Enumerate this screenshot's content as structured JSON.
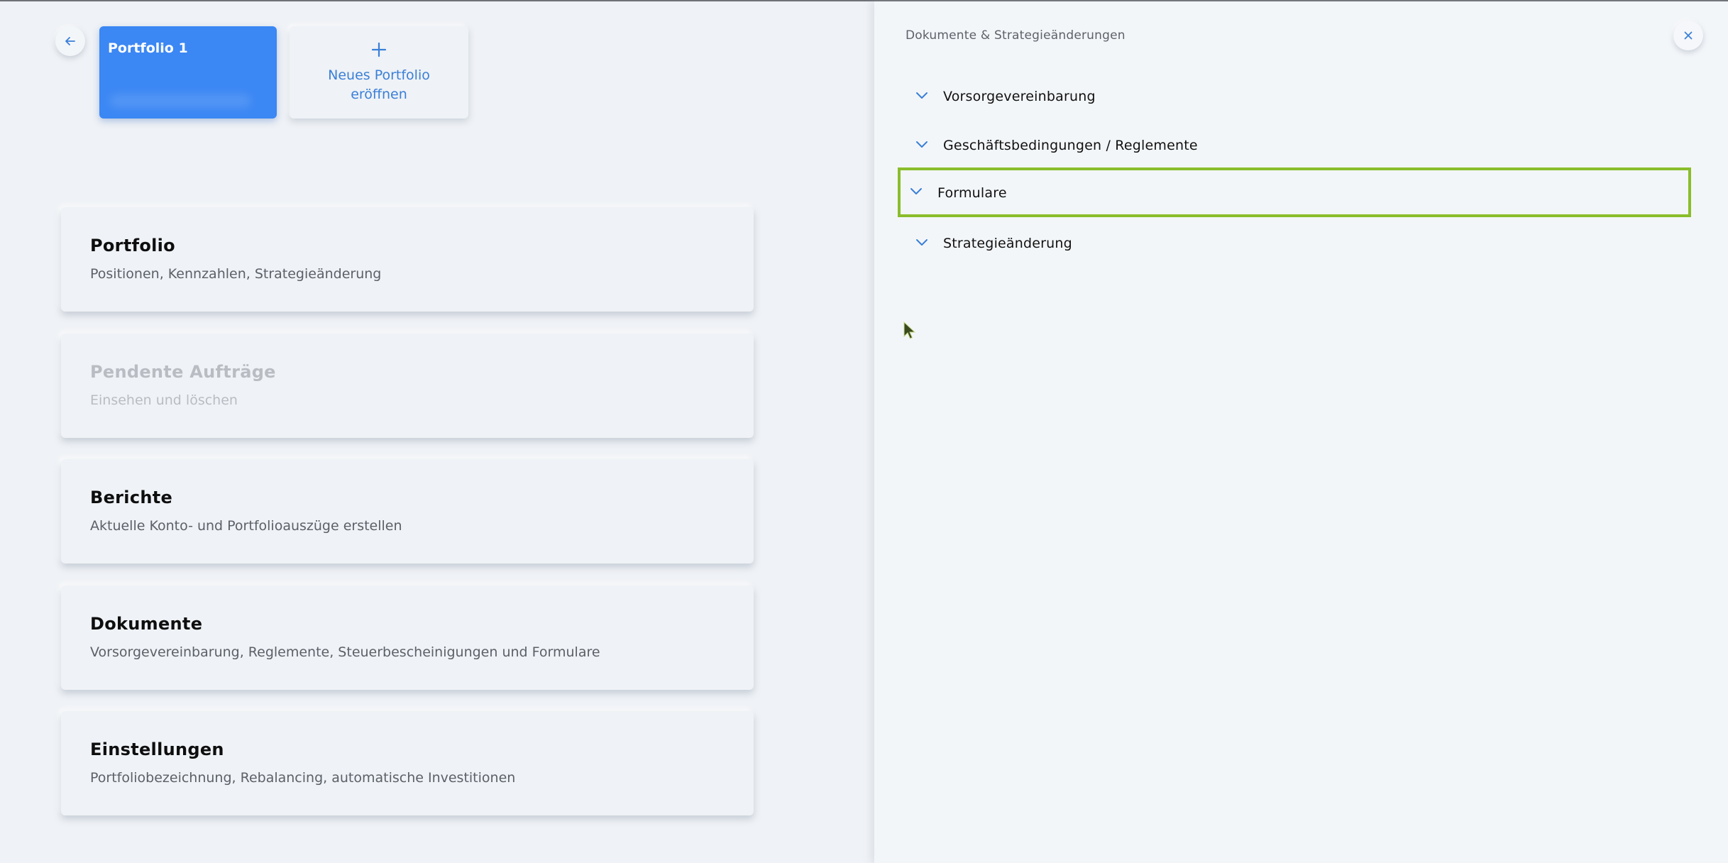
{
  "portfolio_switcher": {
    "back_icon": "arrow-left-icon",
    "active_portfolio": "Portfolio 1",
    "new_portfolio_icon": "plus-icon",
    "new_portfolio_label": "Neues Portfolio eröffnen"
  },
  "menu_cards": [
    {
      "title": "Portfolio",
      "subtitle": "Positionen, Kennzahlen, Strategieänderung",
      "enabled": true
    },
    {
      "title": "Pendente Aufträge",
      "subtitle": "Einsehen und löschen",
      "enabled": false
    },
    {
      "title": "Berichte",
      "subtitle": "Aktuelle Konto- und Portfolioauszüge erstellen",
      "enabled": true
    },
    {
      "title": "Dokumente",
      "subtitle": "Vorsorgevereinbarung, Reglemente, Steuerbescheinigungen und Formulare",
      "enabled": true
    },
    {
      "title": "Einstellungen",
      "subtitle": "Portfoliobezeichnung, Rebalancing, automatische Investitionen",
      "enabled": true
    }
  ],
  "side_panel": {
    "title": "Dokumente & Strategieänderungen",
    "close_icon": "close-icon",
    "sections": [
      {
        "label": "Vorsorgevereinbarung",
        "icon": "chevron-down-icon",
        "highlighted": false
      },
      {
        "label": "Geschäftsbedingungen / Reglemente",
        "icon": "chevron-down-icon",
        "highlighted": false
      },
      {
        "label": "Formulare",
        "icon": "chevron-down-icon",
        "highlighted": true
      },
      {
        "label": "Strategieänderung",
        "icon": "chevron-down-icon",
        "highlighted": false
      }
    ]
  },
  "colors": {
    "accent_blue": "#3b87f4",
    "link_blue": "#3a7fd8",
    "highlight_green": "#8abd2b",
    "background": "#eff2f6"
  }
}
